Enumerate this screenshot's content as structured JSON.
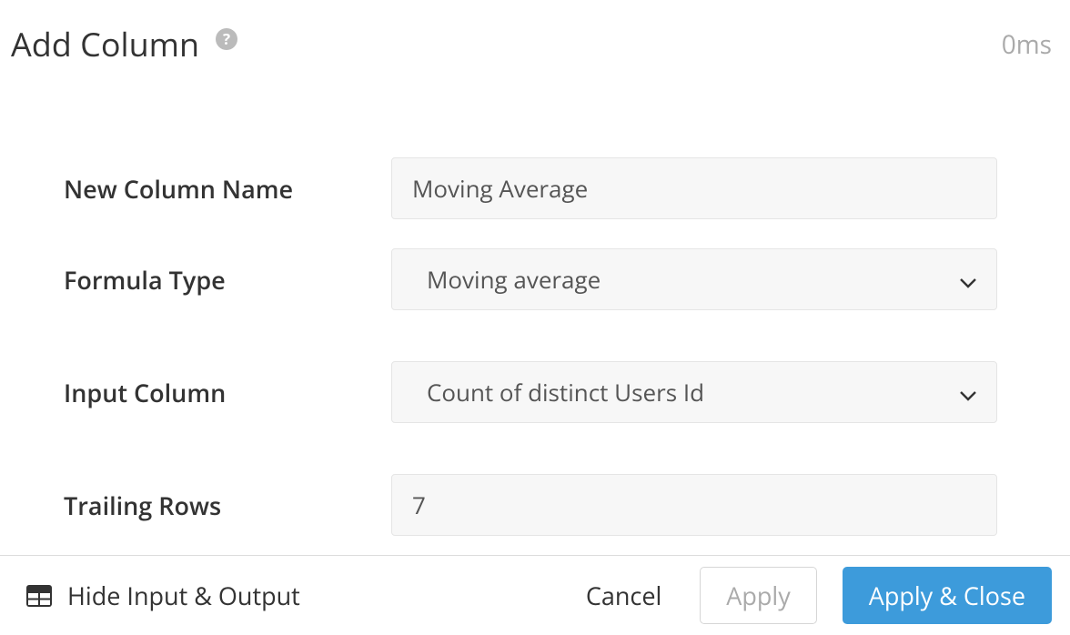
{
  "header": {
    "title": "Add Column",
    "timing": "0ms"
  },
  "form": {
    "new_column_name": {
      "label": "New Column Name",
      "value": "Moving Average"
    },
    "formula_type": {
      "label": "Formula Type",
      "value": "Moving average"
    },
    "input_column": {
      "label": "Input Column",
      "value": "Count of distinct Users Id"
    },
    "trailing_rows": {
      "label": "Trailing Rows",
      "value": "7"
    }
  },
  "footer": {
    "toggle_io": "Hide Input & Output",
    "cancel": "Cancel",
    "apply": "Apply",
    "apply_close": "Apply & Close"
  }
}
